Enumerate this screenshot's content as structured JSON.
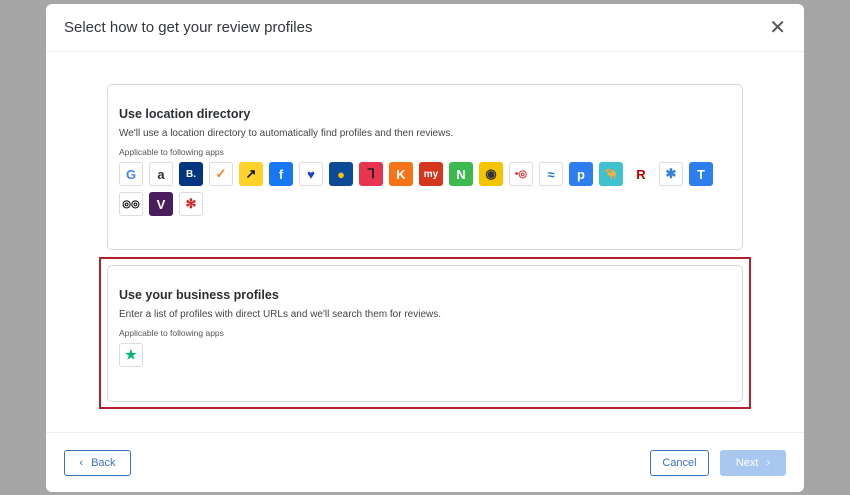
{
  "dialog": {
    "title": "Select how to get your review profiles",
    "close_icon": "close-icon"
  },
  "option1": {
    "title": "Use location directory",
    "description": "We'll use a location directory to automatically find profiles and then reviews.",
    "apps_label": "Applicable to following apps",
    "apps": [
      {
        "name": "google",
        "bg": "#ffffff",
        "fg": "#4285f4",
        "glyph": "G",
        "border": "#dcdcdc"
      },
      {
        "name": "agoda",
        "bg": "#ffffff",
        "fg": "#333333",
        "glyph": "a",
        "border": "#dcdcdc"
      },
      {
        "name": "booking",
        "bg": "#003580",
        "fg": "#ffffff",
        "glyph": "B."
      },
      {
        "name": "checkmark-app",
        "bg": "#ffffff",
        "fg": "#f0822e",
        "glyph": "✓",
        "border": "#dcdcdc"
      },
      {
        "name": "arrow-app",
        "bg": "#ffd22a",
        "fg": "#111111",
        "glyph": "↗"
      },
      {
        "name": "facebook",
        "bg": "#1877f2",
        "fg": "#ffffff",
        "glyph": "f"
      },
      {
        "name": "heart-app",
        "bg": "#ffffff",
        "fg": "#2142d6",
        "glyph": "♥",
        "border": "#dcdcdc"
      },
      {
        "name": "dot-app",
        "bg": "#0a4a97",
        "fg": "#f5c400",
        "glyph": "●"
      },
      {
        "name": "square-app",
        "bg": "#e8344e",
        "fg": "#222222",
        "glyph": "ᒣ"
      },
      {
        "name": "k-app",
        "bg": "#f77318",
        "fg": "#ffffff",
        "glyph": "K"
      },
      {
        "name": "my-app",
        "bg": "#d4371c",
        "fg": "#ffffff",
        "glyph": "my"
      },
      {
        "name": "n-app",
        "bg": "#3dba4e",
        "fg": "#ffffff",
        "glyph": "N"
      },
      {
        "name": "circle-app",
        "bg": "#f5c400",
        "fg": "#333333",
        "glyph": "◉"
      },
      {
        "name": "red-dot-app",
        "bg": "#ffffff",
        "fg": "#e52c2c",
        "glyph": "•◎",
        "border": "#dcdcdc"
      },
      {
        "name": "wave-app",
        "bg": "#ffffff",
        "fg": "#1b72c8",
        "glyph": "≈",
        "border": "#dcdcdc"
      },
      {
        "name": "p-app",
        "bg": "#2d7ff0",
        "fg": "#ffffff",
        "glyph": "p"
      },
      {
        "name": "camel-app",
        "bg": "#3ec2cf",
        "fg": "#ffffff",
        "glyph": "🐪"
      },
      {
        "name": "rakuten",
        "bg": "#ffffff",
        "fg": "#bf0000",
        "glyph": "R"
      },
      {
        "name": "star-app",
        "bg": "#ffffff",
        "fg": "#3b82d6",
        "glyph": "✱",
        "border": "#dcdcdc"
      },
      {
        "name": "t-app",
        "bg": "#2d7ff0",
        "fg": "#ffffff",
        "glyph": "T"
      },
      {
        "name": "tripadvisor",
        "bg": "#ffffff",
        "fg": "#000000",
        "glyph": "◎◎",
        "border": "#dcdcdc"
      },
      {
        "name": "v-app",
        "bg": "#4a1d5c",
        "fg": "#ffffff",
        "glyph": "V"
      },
      {
        "name": "yelp",
        "bg": "#ffffff",
        "fg": "#d32323",
        "glyph": "✻",
        "border": "#dcdcdc"
      }
    ]
  },
  "option2": {
    "title": "Use your business profiles",
    "description": "Enter a list of profiles with direct URLs and we'll search them for reviews.",
    "apps_label": "Applicable to following apps",
    "apps": [
      {
        "name": "trustpilot",
        "bg": "#ffffff",
        "fg": "#00b67a",
        "glyph": "★",
        "border": "#dcdcdc"
      }
    ]
  },
  "footer": {
    "back": "Back",
    "cancel": "Cancel",
    "next": "Next"
  },
  "colors": {
    "accent": "#3b73b9",
    "highlight": "#b5202e",
    "next_disabled": "#a9c8f0"
  }
}
